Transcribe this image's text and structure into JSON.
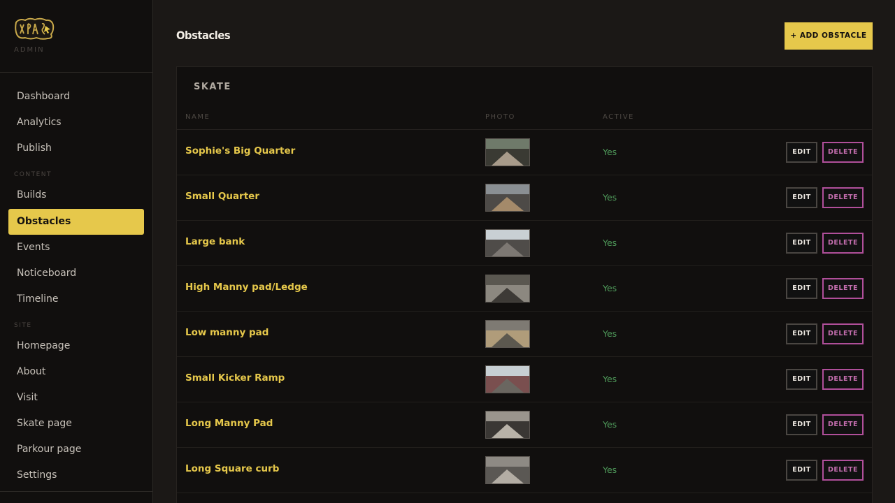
{
  "brand": {
    "subtitle": "ADMIN"
  },
  "sidebar": {
    "items_top": [
      {
        "label": "Dashboard"
      },
      {
        "label": "Analytics"
      },
      {
        "label": "Publish"
      }
    ],
    "content_section": "CONTENT",
    "content_items": [
      {
        "label": "Builds"
      },
      {
        "label": "Obstacles",
        "active": true
      },
      {
        "label": "Events"
      },
      {
        "label": "Noticeboard"
      },
      {
        "label": "Timeline"
      }
    ],
    "site_section": "SITE",
    "site_items": [
      {
        "label": "Homepage"
      },
      {
        "label": "About"
      },
      {
        "label": "Visit"
      },
      {
        "label": "Skate page"
      },
      {
        "label": "Parkour page"
      },
      {
        "label": "Settings"
      }
    ]
  },
  "header": {
    "title": "Obstacles",
    "add_button": "+ ADD OBSTACLE"
  },
  "panel": {
    "title": "SKATE",
    "columns": {
      "name": "NAME",
      "photo": "PHOTO",
      "active": "ACTIVE"
    },
    "edit_label": "EDIT",
    "delete_label": "DELETE",
    "rows": [
      {
        "name": "Sophie's Big Quarter",
        "active": "Yes",
        "thumb": [
          "#6f7a6a",
          "#3a3a33",
          "#a89b8a"
        ]
      },
      {
        "name": "Small Quarter",
        "active": "Yes",
        "thumb": [
          "#8a8f93",
          "#4d4a47",
          "#a48a6a"
        ]
      },
      {
        "name": "Large bank",
        "active": "Yes",
        "thumb": [
          "#c9d0d4",
          "#4f4c49",
          "#7d7873"
        ]
      },
      {
        "name": "High Manny pad/Ledge",
        "active": "Yes",
        "thumb": [
          "#5a5750",
          "#8c8880",
          "#3d3a36"
        ]
      },
      {
        "name": "Low manny pad",
        "active": "Yes",
        "thumb": [
          "#7e7a73",
          "#b09c7a",
          "#5c584f"
        ]
      },
      {
        "name": "Small Kicker Ramp",
        "active": "Yes",
        "thumb": [
          "#c7cfd3",
          "#7a4f4f",
          "#6a6660"
        ]
      },
      {
        "name": "Long Manny Pad",
        "active": "Yes",
        "thumb": [
          "#9a958d",
          "#3a3734",
          "#b8b2a8"
        ]
      },
      {
        "name": "Long Square curb",
        "active": "Yes",
        "thumb": [
          "#8e8a84",
          "#5b5854",
          "#b3ada4"
        ]
      }
    ]
  },
  "colors": {
    "accent": "#e6c84b",
    "active_green": "#4f9a5a",
    "delete_pink": "#c56fb0"
  }
}
